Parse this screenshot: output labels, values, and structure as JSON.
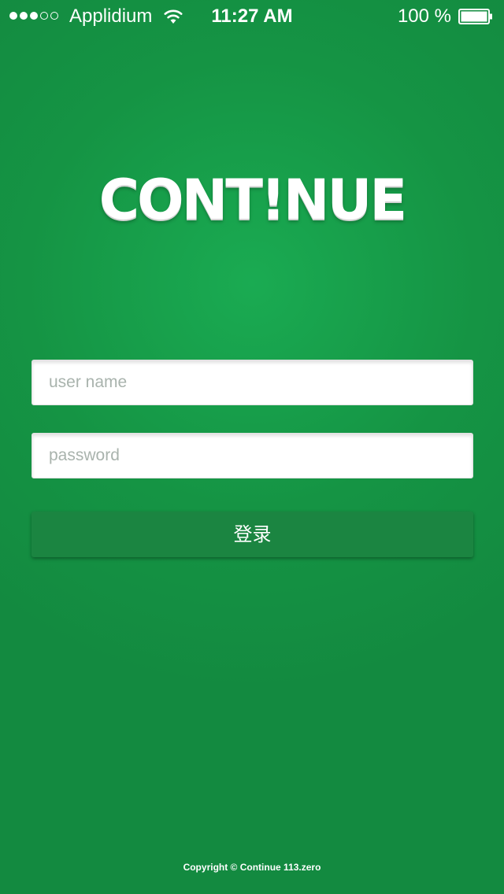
{
  "status_bar": {
    "signal_bars_filled": 3,
    "signal_bars_total": 5,
    "carrier": "Applidium",
    "time": "11:27 AM",
    "battery_percent": "100 %",
    "battery_level": 1.0,
    "icons": [
      "signal-icon",
      "wifi-icon",
      "battery-icon"
    ]
  },
  "logo": {
    "text": "CONT!NUE"
  },
  "login_form": {
    "username_placeholder": "user name",
    "username_value": "",
    "password_placeholder": "password",
    "password_value": "",
    "submit_label": "登录"
  },
  "footer": {
    "copyright": "Copyright © Continue 113.zero"
  },
  "colors": {
    "background": "#159444",
    "background_center": "#1aab52",
    "button": "#1b8541",
    "placeholder": "#a9b3ad"
  }
}
